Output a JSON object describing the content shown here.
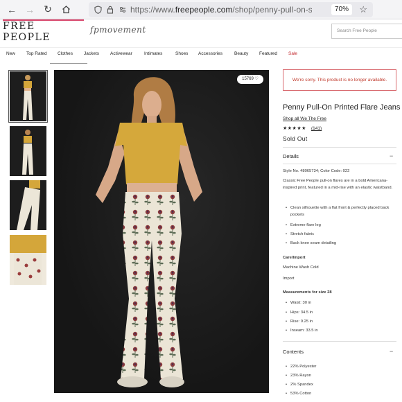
{
  "browser": {
    "url_prefix": "https://www.",
    "url_domain": "freepeople.com",
    "url_path": "/shop/penny-pull-on-stars-str",
    "zoom": "70%"
  },
  "header": {
    "logo": "FREE PEOPLE",
    "sub_brand": "fpmovement",
    "search_placeholder": "Search Free People"
  },
  "nav": {
    "items": [
      "New",
      "Top Rated",
      "Clothes",
      "Jackets",
      "Activewear",
      "Intimates",
      "Shoes",
      "Accessories",
      "Beauty",
      "Featured",
      "Sale"
    ],
    "active": "Clothes"
  },
  "gallery": {
    "badge": "15769 ♡"
  },
  "product": {
    "unavailable_notice": "We're sorry. This product is no longer available.",
    "title": "Penny Pull-On Printed Flare Jeans",
    "shop_link": "Shop all We The Free",
    "rating_stars": "★★★★★",
    "review_count": "(141)",
    "status": "Sold Out",
    "details_heading": "Details",
    "style_info": "Style No. 48065734; Color Code: 022",
    "description": "Classic Free People pull-on flares are in a bold Americana-inspired print, featured in a mid-rise with an elastic waistband.",
    "features": [
      "Clean silhouette with a flat front & perfectly placed back pockets",
      "Extreme flare leg",
      "Stretch fabric",
      "Back knee seam detailing"
    ],
    "care_heading": "Care/Import",
    "care": "Machine Wash Cold",
    "import": "Import",
    "measurements_heading": "Measurements for size 28",
    "measurements": [
      "Waist: 30 in",
      "Hips: 34.5 in",
      "Rise: 9.25 in",
      "Inseam: 33.5 in"
    ],
    "contents_heading": "Contents",
    "contents": [
      "22% Polyester",
      "23% Rayon",
      "2% Spandex",
      "53% Cotton"
    ]
  }
}
